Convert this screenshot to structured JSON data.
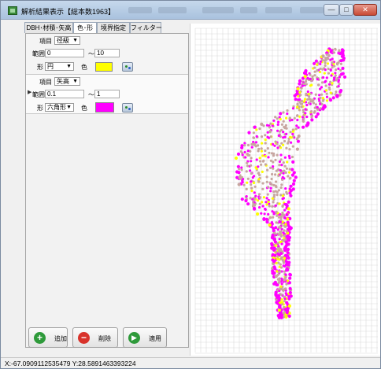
{
  "window": {
    "title": "解析結果表示【総本数1963】",
    "min_glyph": "—",
    "max_glyph": "□",
    "close_glyph": "✕"
  },
  "tabs": [
    {
      "label": "DBH･材積･矢高"
    },
    {
      "label": "色･形"
    },
    {
      "label": "境界指定"
    },
    {
      "label": "フィルター"
    }
  ],
  "groups": [
    {
      "item_label": "項目",
      "item_value": "径級",
      "range_label": "範囲",
      "range_from": "0",
      "range_sep": "～",
      "range_to": "10",
      "shape_label": "形",
      "shape_value": "円",
      "color_label": "色",
      "color_hex": "#ffff00"
    },
    {
      "item_label": "項目",
      "item_value": "矢高",
      "range_label": "範囲",
      "range_from": "0.1",
      "range_sep": "～",
      "range_to": "1",
      "shape_label": "形",
      "shape_value": "六角形",
      "color_label": "色",
      "color_hex": "#ff00ff"
    }
  ],
  "buttons": {
    "add_label": "追加",
    "delete_label": "削除",
    "apply_label": "適用"
  },
  "status": {
    "coords": "X:-67.0909112535479 Y:28.5891463393224"
  },
  "plot": {
    "colors": {
      "magenta": "#ff00ff",
      "yellow": "#ffff00",
      "tan": "#c7a6a0",
      "grid": "#d9d9d9"
    }
  }
}
